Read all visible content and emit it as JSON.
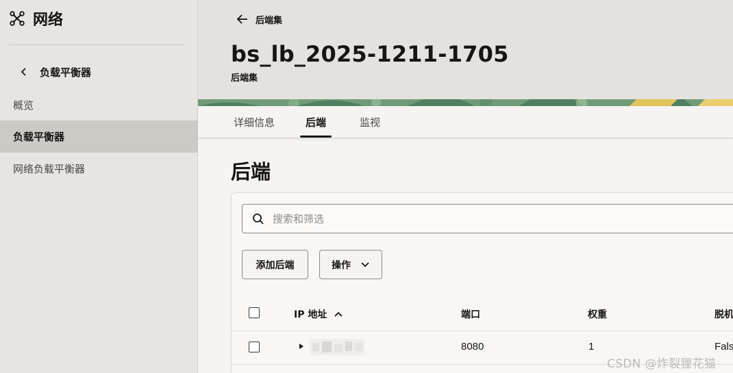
{
  "sidebar": {
    "title": "网络",
    "title_icon": "network-icon",
    "back_label": "负载平衡器",
    "items": [
      {
        "label": "概览",
        "active": false
      },
      {
        "label": "负载平衡器",
        "active": true
      },
      {
        "label": "网络负载平衡器",
        "active": false
      }
    ]
  },
  "header": {
    "back_label": "后端集",
    "title": "bs_lb_2025-1211-1705",
    "subtitle": "后端集"
  },
  "tabs": [
    {
      "label": "详细信息",
      "active": false
    },
    {
      "label": "后端",
      "active": true
    },
    {
      "label": "监视",
      "active": false
    }
  ],
  "section": {
    "title": "后端",
    "search_placeholder": "搜索和筛选",
    "add_button": "添加后端",
    "actions_button": "操作"
  },
  "table": {
    "columns": [
      "IP 地址",
      "端口",
      "权重",
      "脱机"
    ],
    "sort_indicator": "ascending",
    "rows": [
      {
        "ip": "",
        "port": "8080",
        "weight": "1",
        "offline": "Fals"
      }
    ]
  },
  "watermark": "CSDN @炸裂狸花猫",
  "colors": {
    "sidebar_bg": "#e7e5e1",
    "sidebar_active": "#cdcac5",
    "header_bg": "#e4e2de",
    "text": "#161513",
    "banner_green": "#5a8f6a",
    "banner_yellow": "#e3c35c"
  }
}
